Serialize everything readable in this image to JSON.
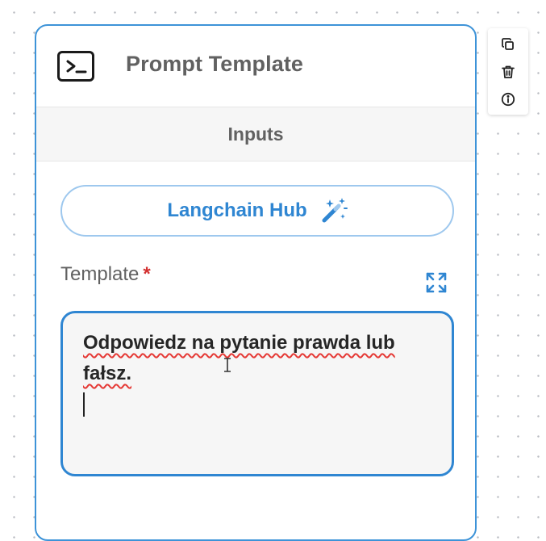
{
  "node": {
    "title": "Prompt Template",
    "icon": "terminal-icon",
    "section_label": "Inputs",
    "hub_button": {
      "label": "Langchain Hub",
      "icon": "magic-wand-icon"
    },
    "template_field": {
      "label": "Template",
      "required_marker": "*",
      "expand_icon": "expand-icon",
      "value_lines": [
        "Odpowiedz na pytanie prawda lub",
        "fałsz."
      ]
    }
  },
  "toolbar": {
    "items": [
      {
        "icon": "copy-icon"
      },
      {
        "icon": "trash-icon"
      },
      {
        "icon": "info-icon"
      }
    ]
  },
  "colors": {
    "accent": "#3d93d8",
    "accent_text": "#2f86d2",
    "required": "#d32f2f",
    "spellcheck": "#e53935"
  }
}
